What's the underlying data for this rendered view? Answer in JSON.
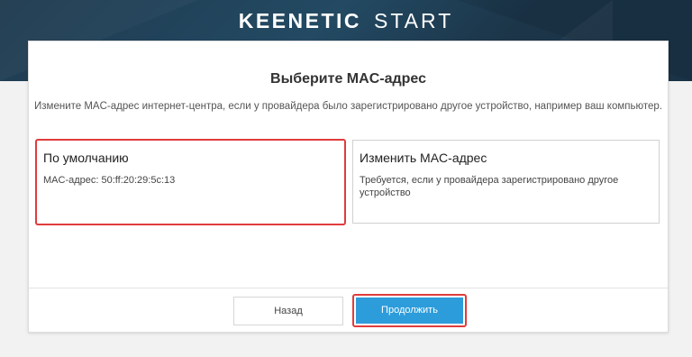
{
  "header": {
    "brand": "KEENETIC",
    "product": "START"
  },
  "wizard": {
    "title": "Выберите MAC-адрес",
    "subtitle": "Измените MAC-адрес интернет-центра, если у провайдера было зарегистрировано другое устройство, например ваш компьютер.",
    "options": [
      {
        "title": "По умолчанию",
        "description": "MAC-адрес: 50:ff:20:29:5c:13",
        "selected": true
      },
      {
        "title": "Изменить MAC-адрес",
        "description": "Требуется, если у провайдера зарегистрировано другое устройство",
        "selected": false
      }
    ],
    "back_label": "Назад",
    "continue_label": "Продолжить"
  },
  "colors": {
    "header_bg": "#1f3a4f",
    "accent": "#2d9cdb",
    "highlight": "#e03c3c"
  }
}
